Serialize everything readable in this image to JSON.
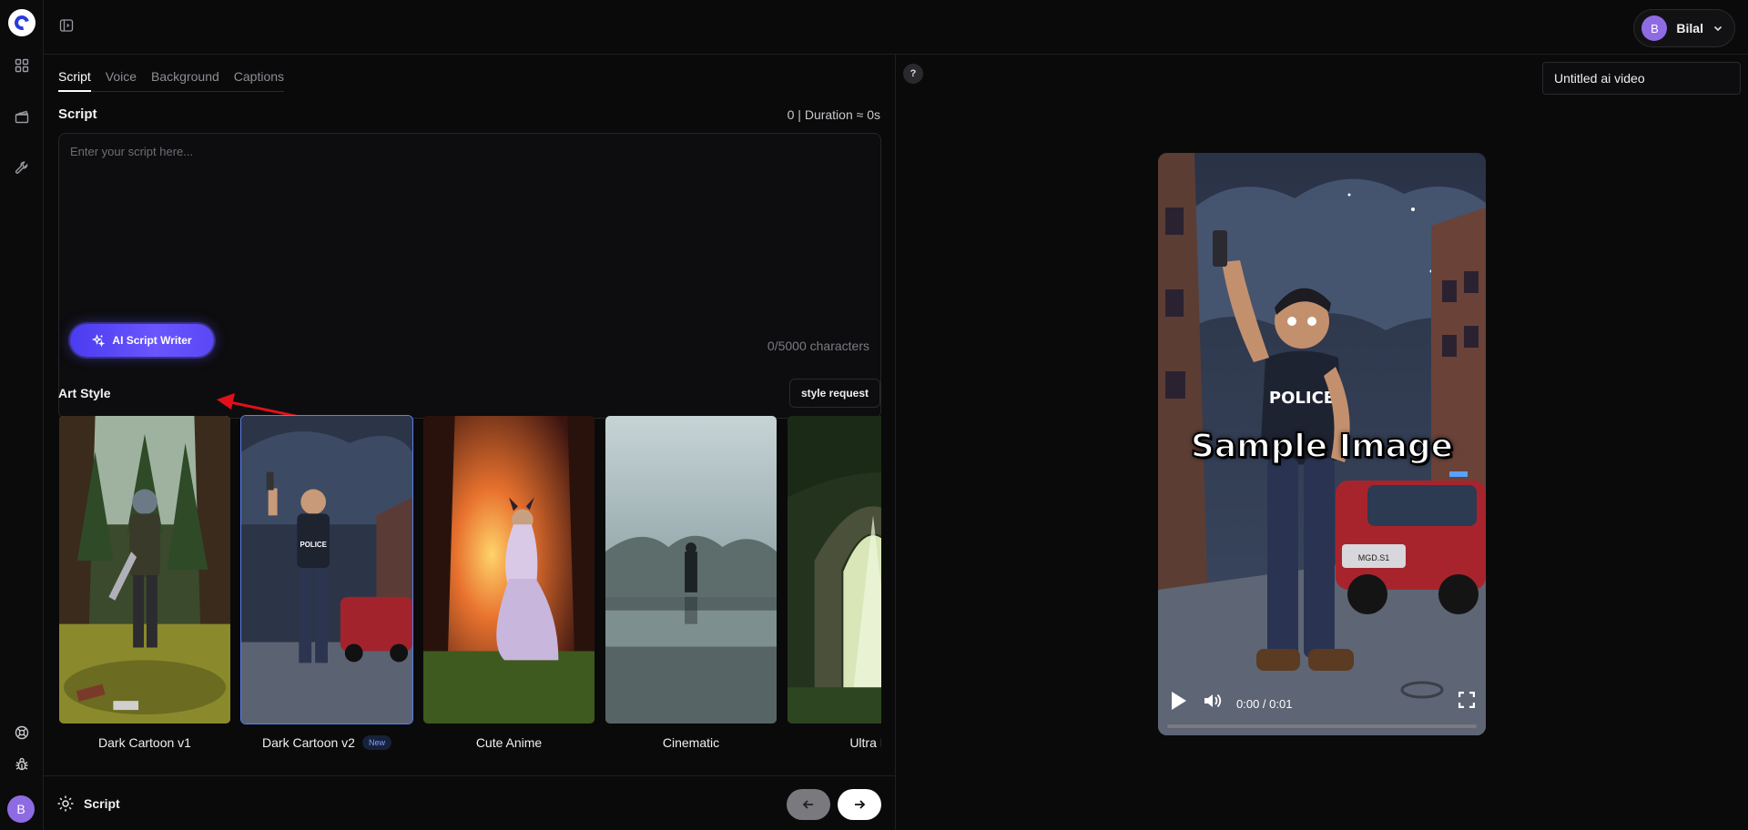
{
  "user": {
    "initial": "B",
    "name": "Bilal"
  },
  "tabs": [
    "Script",
    "Voice",
    "Background",
    "Captions"
  ],
  "script": {
    "section_title": "Script",
    "duration_label": "0 | Duration ≈ 0s",
    "placeholder": "Enter your script here...",
    "char_count": "0/5000 characters",
    "ai_button_label": "AI Script Writer"
  },
  "art_style": {
    "section_title": "Art Style",
    "request_label": "style request",
    "styles": [
      {
        "label": "Dark Cartoon v1",
        "badge": ""
      },
      {
        "label": "Dark Cartoon v2",
        "badge": "New"
      },
      {
        "label": "Cute Anime",
        "badge": ""
      },
      {
        "label": "Cinematic",
        "badge": ""
      },
      {
        "label": "Ultra Re",
        "badge": ""
      }
    ],
    "selected_index": 1
  },
  "footer": {
    "step_label": "Script"
  },
  "preview": {
    "help_label": "?",
    "video_title": "Untitled ai video",
    "overlay_text": "Sample Image",
    "time": "0:00 / 0:01",
    "progress_fraction": 0.0,
    "scene_text": {
      "police": "POLICE",
      "plate": "MGD.S1"
    }
  },
  "colors": {
    "accent": "#5a48f5",
    "avatar": "#8f6be3",
    "selected_border": "#5c7ff0"
  }
}
